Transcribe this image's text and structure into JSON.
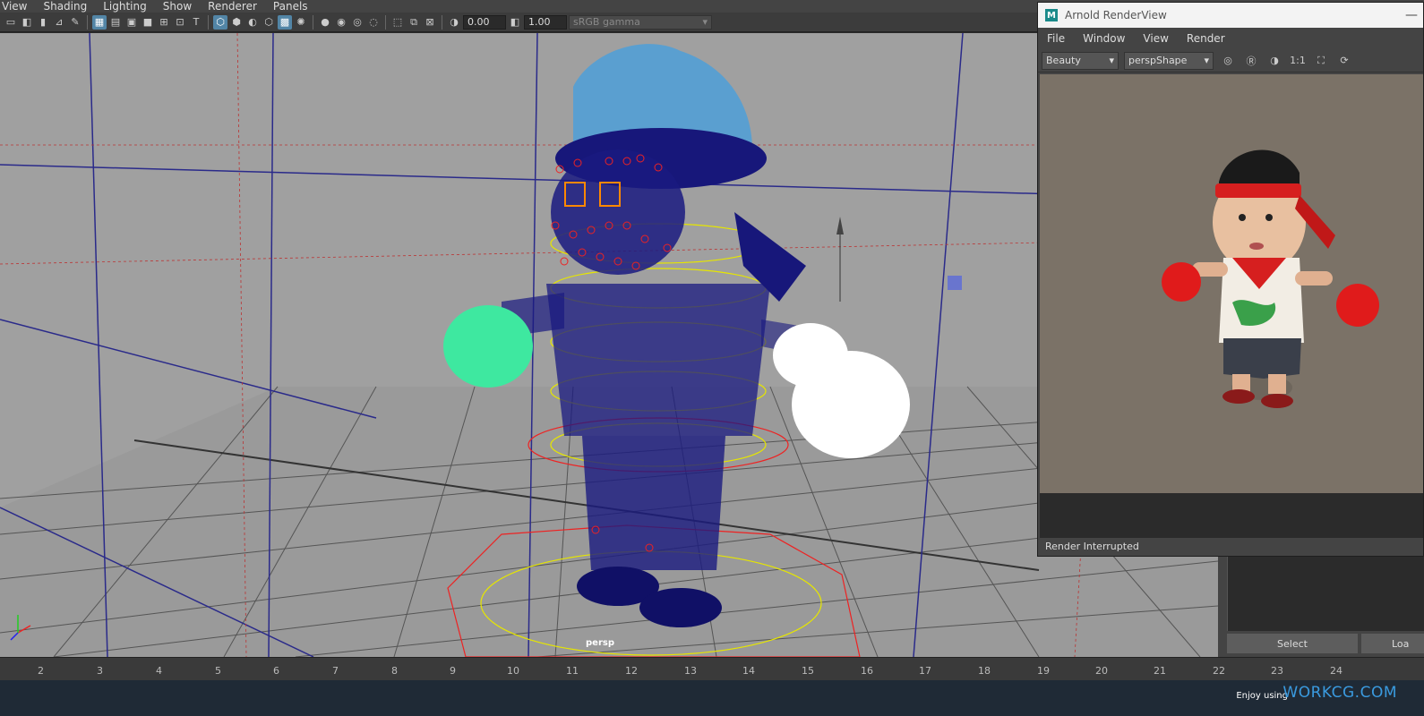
{
  "maya_menu": [
    "View",
    "Shading",
    "Lighting",
    "Show",
    "Renderer",
    "Panels"
  ],
  "toolbar": {
    "exposure_value": "0.00",
    "gamma_value": "1.00",
    "color_space": "sRGB gamma"
  },
  "viewport": {
    "camera_label": "persp"
  },
  "timeslider": {
    "ticks": [
      "2",
      "3",
      "4",
      "5",
      "6",
      "7",
      "8",
      "9",
      "10",
      "11",
      "12",
      "13",
      "14",
      "15",
      "16",
      "17",
      "18",
      "19",
      "20",
      "21",
      "22",
      "23",
      "24"
    ]
  },
  "footer": {
    "enjoy_text": "Enjoy using",
    "brand": "WORKCG.COM"
  },
  "right_panel": {
    "select_label": "Select",
    "load_label": "Loa"
  },
  "arnold": {
    "title": "Arnold RenderView",
    "menu": [
      "File",
      "Window",
      "View",
      "Render"
    ],
    "aov": "Beauty",
    "camera": "perspShape",
    "ratio": "1:1",
    "status": "Render Interrupted"
  }
}
